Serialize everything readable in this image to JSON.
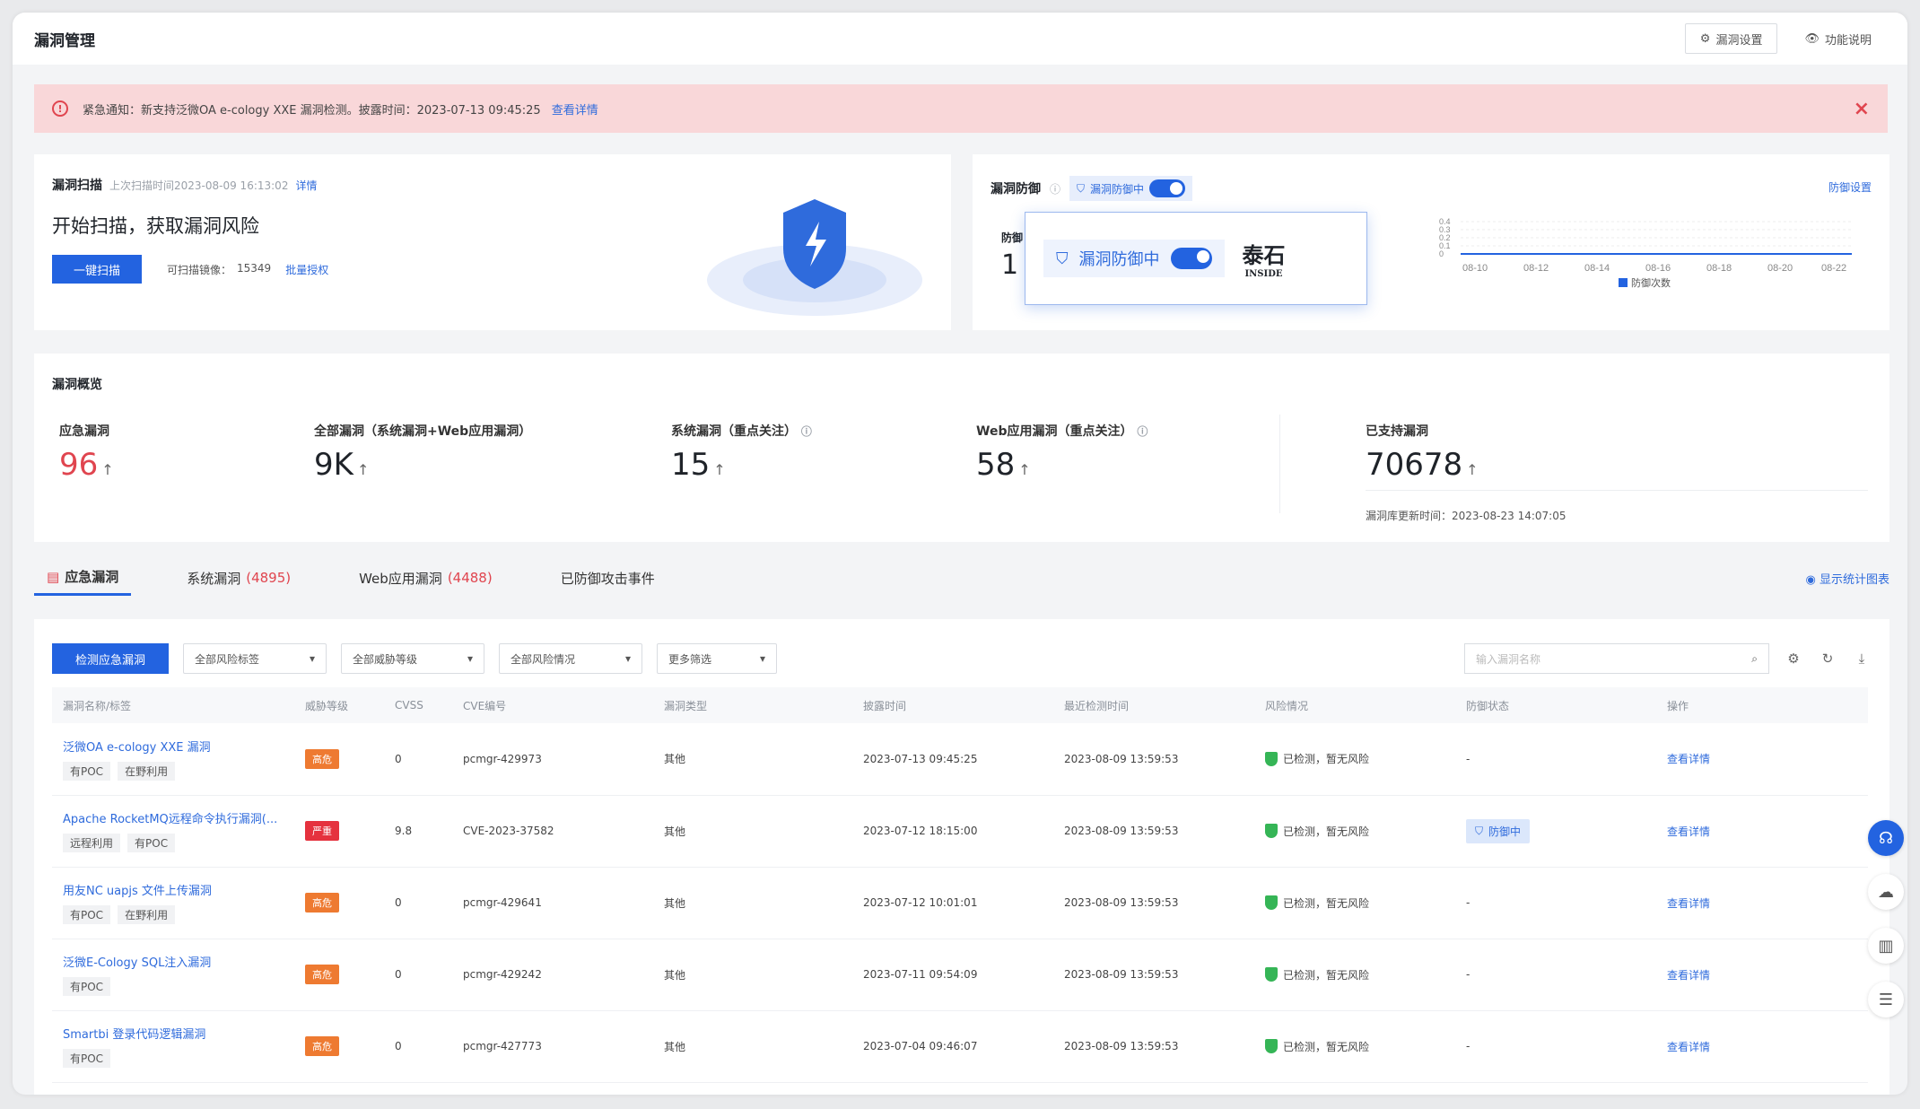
{
  "page": {
    "title": "漏洞管理",
    "settings_btn": "漏洞设置",
    "help_btn": "功能说明"
  },
  "alert": {
    "text": "紧急通知：新支持泛微OA e-cology XXE 漏洞检测。披露时间：2023-07-13 09:45:25",
    "link": "查看详情"
  },
  "scan": {
    "title": "漏洞扫描",
    "last_scan": "上次扫描时间2023-08-09 16:13:02",
    "detail_link": "详情",
    "headline": "开始扫描，获取漏洞风险",
    "button": "一键扫描",
    "images_label": "可扫描镜像：",
    "images_count": "15349",
    "auth_link": "批量授权"
  },
  "defense": {
    "title": "漏洞防御",
    "status": "漏洞防御中",
    "settings_link": "防御设置",
    "popup_status": "漏洞防御中",
    "brand": "泰石",
    "brand_sub": "INSIDE",
    "stat_label": "防御",
    "stat_value": "1",
    "legend": "防御次数",
    "y_ticks": [
      "0.4",
      "0.3",
      "0.2",
      "0.1",
      "0"
    ],
    "x_ticks": [
      "08-10",
      "08-12",
      "08-14",
      "08-16",
      "08-18",
      "08-20",
      "08-22"
    ]
  },
  "overview": {
    "title": "漏洞概览",
    "items": [
      {
        "label": "应急漏洞",
        "value": "96"
      },
      {
        "label": "全部漏洞（系统漏洞+Web应用漏洞）",
        "value": "9K"
      },
      {
        "label": "系统漏洞（重点关注）",
        "value": "15"
      },
      {
        "label": "Web应用漏洞（重点关注）",
        "value": "58"
      },
      {
        "label": "已支持漏洞",
        "value": "70678"
      }
    ],
    "update_label": "漏洞库更新时间：",
    "update_time": "2023-08-23 14:07:05"
  },
  "tabs": [
    {
      "label": "应急漏洞",
      "count": ""
    },
    {
      "label": "系统漏洞",
      "count": "(4895)"
    },
    {
      "label": "Web应用漏洞",
      "count": "(4488)"
    },
    {
      "label": "已防御攻击事件",
      "count": ""
    }
  ],
  "show_stats": "显示统计图表",
  "filters": {
    "detect_btn": "检测应急漏洞",
    "risk_tag": "全部风险标签",
    "threat_level": "全部威胁等级",
    "risk_status": "全部风险情况",
    "more": "更多筛选",
    "search_placeholder": "输入漏洞名称"
  },
  "columns": [
    "漏洞名称/标签",
    "威胁等级",
    "CVSS",
    "CVE编号",
    "漏洞类型",
    "披露时间",
    "最近检测时间",
    "风险情况",
    "防御状态",
    "操作"
  ],
  "rows": [
    {
      "name": "泛微OA e-cology XXE 漏洞",
      "tags": [
        "有POC",
        "在野利用"
      ],
      "level": "高危",
      "cvss": "0",
      "cve": "pcmgr-429973",
      "type": "其他",
      "disclosed": "2023-07-13 09:45:25",
      "checked": "2023-08-09 13:59:53",
      "risk": "已检测，暂无风险",
      "defense": "-",
      "action": "查看详情"
    },
    {
      "name": "Apache RocketMQ远程命令执行漏洞(...",
      "tags": [
        "远程利用",
        "有POC"
      ],
      "level": "严重",
      "cvss": "9.8",
      "cve": "CVE-2023-37582",
      "type": "其他",
      "disclosed": "2023-07-12 18:15:00",
      "checked": "2023-08-09 13:59:53",
      "risk": "已检测，暂无风险",
      "defense": "防御中",
      "action": "查看详情"
    },
    {
      "name": "用友NC uapjs 文件上传漏洞",
      "tags": [
        "有POC",
        "在野利用"
      ],
      "level": "高危",
      "cvss": "0",
      "cve": "pcmgr-429641",
      "type": "其他",
      "disclosed": "2023-07-12 10:01:01",
      "checked": "2023-08-09 13:59:53",
      "risk": "已检测，暂无风险",
      "defense": "-",
      "action": "查看详情"
    },
    {
      "name": "泛微E-Cology SQL注入漏洞",
      "tags": [
        "有POC"
      ],
      "level": "高危",
      "cvss": "0",
      "cve": "pcmgr-429242",
      "type": "其他",
      "disclosed": "2023-07-11 09:54:09",
      "checked": "2023-08-09 13:59:53",
      "risk": "已检测，暂无风险",
      "defense": "-",
      "action": "查看详情"
    },
    {
      "name": "Smartbi 登录代码逻辑漏洞",
      "tags": [
        "有POC"
      ],
      "level": "高危",
      "cvss": "0",
      "cve": "pcmgr-427773",
      "type": "其他",
      "disclosed": "2023-07-04 09:46:07",
      "checked": "2023-08-09 13:59:53",
      "risk": "已检测，暂无风险",
      "defense": "-",
      "action": "查看详情"
    }
  ],
  "colors": {
    "primary": "#2363e0",
    "high": "#ee7a31",
    "critical": "#e5323e",
    "alert_bg": "#f9d7d9",
    "safe": "#35b556"
  },
  "icons": {
    "settings": "gear-icon",
    "help": "eye-icon",
    "alert": "warning-circle-icon",
    "close": "close-icon",
    "shield": "shield-icon",
    "search": "search-icon",
    "refresh": "refresh-icon",
    "download": "download-icon"
  }
}
